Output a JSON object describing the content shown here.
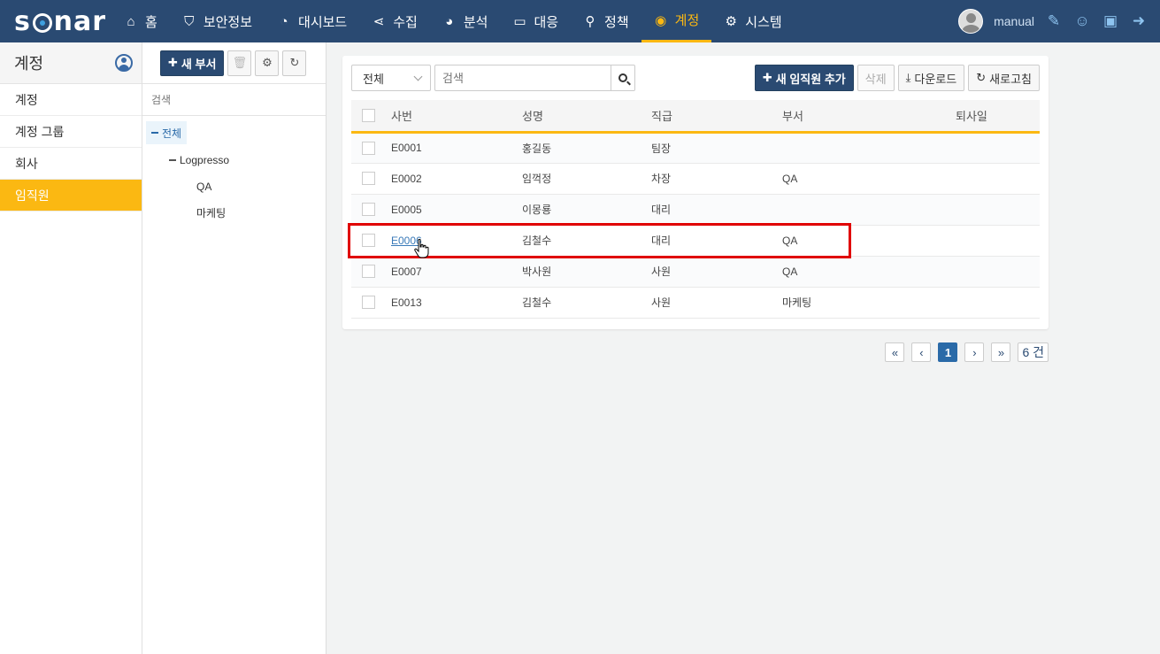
{
  "app": {
    "logo": "sonar",
    "username": "manual"
  },
  "nav": {
    "items": [
      {
        "label": "홈",
        "icon": "home-icon"
      },
      {
        "label": "보안정보",
        "icon": "shield-icon"
      },
      {
        "label": "대시보드",
        "icon": "dashboard-icon"
      },
      {
        "label": "수집",
        "icon": "share-icon"
      },
      {
        "label": "분석",
        "icon": "pie-chart-icon"
      },
      {
        "label": "대응",
        "icon": "laptop-icon"
      },
      {
        "label": "정책",
        "icon": "search-icon"
      },
      {
        "label": "계정",
        "icon": "user-circle-icon",
        "active": true
      },
      {
        "label": "시스템",
        "icon": "gear-icon"
      }
    ],
    "active_color": "#fbb812",
    "bar_color": "#2a4a72"
  },
  "sidebar": {
    "title": "계정",
    "items": [
      {
        "label": "계정"
      },
      {
        "label": "계정 그룹"
      },
      {
        "label": "회사"
      },
      {
        "label": "임직원",
        "active": true
      }
    ]
  },
  "dept": {
    "new_button": "새 부서",
    "search_placeholder": "검색",
    "tree": {
      "root": "전체",
      "child": "Logpresso",
      "leaves": [
        "QA",
        "마케팅"
      ]
    }
  },
  "employees": {
    "filter_value": "전체",
    "search_placeholder": "검색",
    "buttons": {
      "add": "새 임직원 추가",
      "delete": "삭제",
      "download": "다운로드",
      "refresh": "새로고침"
    },
    "columns": [
      "사번",
      "성명",
      "직급",
      "부서",
      "퇴사일"
    ],
    "rows": [
      {
        "id": "E0001",
        "name": "홍길동",
        "rank": "팀장",
        "dept": "",
        "left": ""
      },
      {
        "id": "E0002",
        "name": "임꺽정",
        "rank": "차장",
        "dept": "QA",
        "left": ""
      },
      {
        "id": "E0005",
        "name": "이몽룡",
        "rank": "대리",
        "dept": "",
        "left": ""
      },
      {
        "id": "E0006",
        "name": "김철수",
        "rank": "대리",
        "dept": "QA",
        "left": ""
      },
      {
        "id": "E0007",
        "name": "박사원",
        "rank": "사원",
        "dept": "QA",
        "left": ""
      },
      {
        "id": "E0013",
        "name": "김철수",
        "rank": "사원",
        "dept": "마케팅",
        "left": ""
      }
    ],
    "highlight_color": "#e00000"
  },
  "pagination": {
    "first": "«",
    "prev": "‹",
    "current": "1",
    "next": "›",
    "last": "»",
    "count": "6 건"
  }
}
